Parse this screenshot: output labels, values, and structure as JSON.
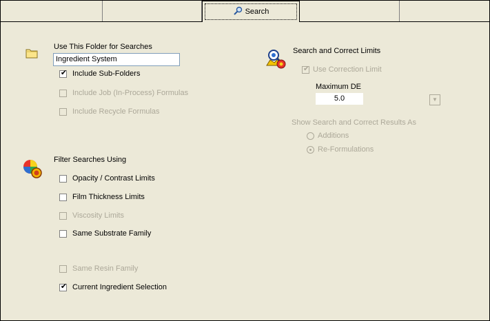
{
  "tabs": [
    {
      "label": ""
    },
    {
      "label": ""
    },
    {
      "label": "Search",
      "icon": "magnifier-icon",
      "active": true
    },
    {
      "label": ""
    },
    {
      "label": ""
    }
  ],
  "folder": {
    "heading": "Use This Folder for Searches",
    "value": "Ingredient System",
    "include_sub_folders": {
      "label": "Include Sub-Folders",
      "checked": true,
      "enabled": true
    },
    "include_job": {
      "label": "Include Job (In-Process) Formulas",
      "checked": false,
      "enabled": false
    },
    "include_recycle": {
      "label": "Include Recycle Formulas",
      "checked": false,
      "enabled": false
    }
  },
  "filter": {
    "heading": "Filter Searches Using",
    "opacity": {
      "label": "Opacity / Contrast Limits",
      "checked": false,
      "enabled": true
    },
    "film": {
      "label": "Film Thickness Limits",
      "checked": false,
      "enabled": true
    },
    "viscosity": {
      "label": "Viscosity Limits",
      "checked": false,
      "enabled": false
    },
    "substrate": {
      "label": "Same Substrate Family",
      "checked": false,
      "enabled": true
    },
    "resin": {
      "label": "Same Resin Family",
      "checked": false,
      "enabled": false
    },
    "ingredient": {
      "label": "Current Ingredient Selection",
      "checked": true,
      "enabled": true
    }
  },
  "correct": {
    "heading": "Search and Correct Limits",
    "use_limit": {
      "label": "Use Correction Limit",
      "checked": true,
      "enabled": false
    },
    "max_de_label": "Maximum DE",
    "max_de_value": "5.0",
    "show_as_label": "Show Search and Correct Results As",
    "additions": {
      "label": "Additions",
      "selected": false
    },
    "reformulations": {
      "label": "Re-Formulations",
      "selected": true
    }
  },
  "colors": {
    "background": "#ece9d8",
    "disabled_text": "#aca899"
  }
}
